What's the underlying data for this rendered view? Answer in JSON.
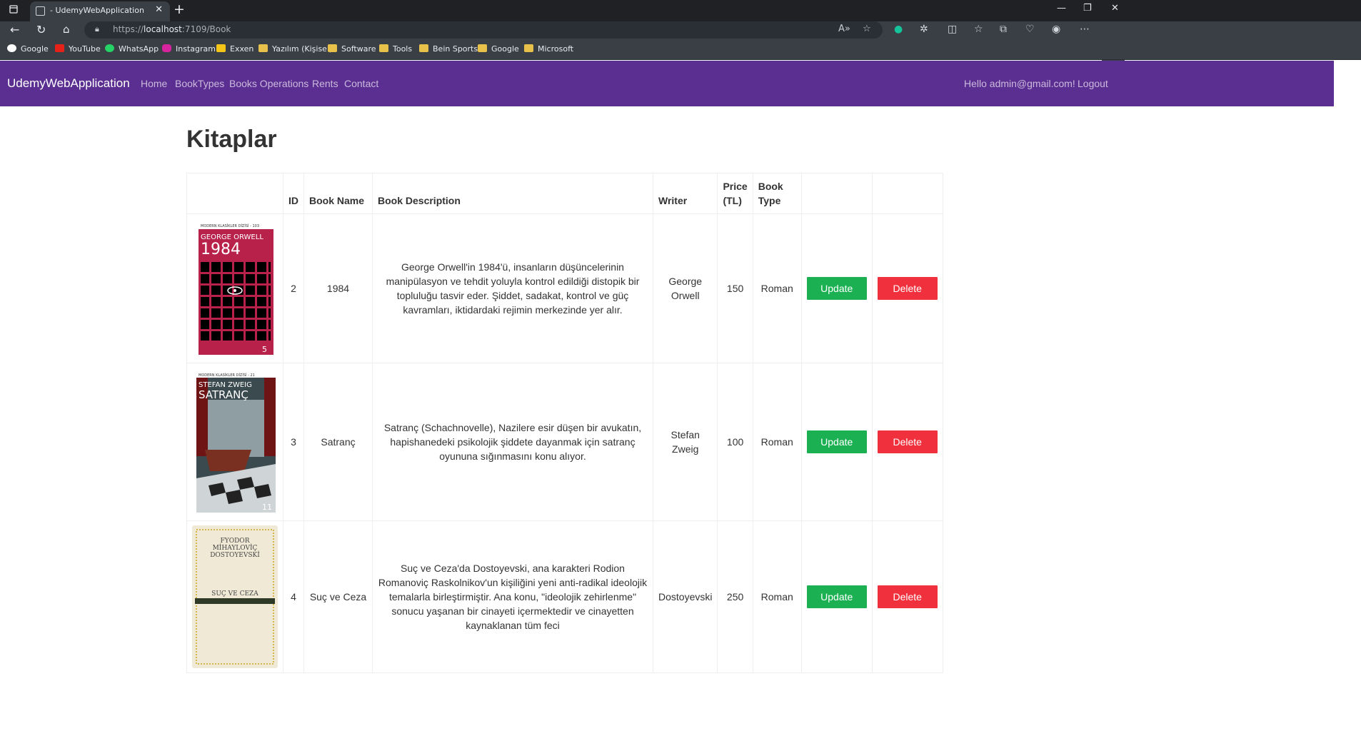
{
  "browser": {
    "tab_title": "- UdemyWebApplication",
    "url_prefix": "https://",
    "url_host": "localhost",
    "url_path": ":7109/Book",
    "bookmarks": [
      {
        "label": "Google",
        "icon": "google-icon",
        "color": "#ffffff"
      },
      {
        "label": "YouTube",
        "icon": "youtube-icon",
        "color": "#e62117"
      },
      {
        "label": "WhatsApp",
        "icon": "whatsapp-icon",
        "color": "#25d366"
      },
      {
        "label": "Instagram",
        "icon": "instagram-icon",
        "color": "#d6249f"
      },
      {
        "label": "Exxen",
        "icon": "exxen-icon",
        "color": "#f5c518"
      },
      {
        "label": "Yazılım (Kişisel)",
        "icon": "folder-icon",
        "color": "#e8c14a"
      },
      {
        "label": "Software",
        "icon": "folder-icon",
        "color": "#e8c14a"
      },
      {
        "label": "Tools",
        "icon": "folder-icon",
        "color": "#e8c14a"
      },
      {
        "label": "Bein Sports",
        "icon": "folder-icon",
        "color": "#e8c14a"
      },
      {
        "label": "Google",
        "icon": "folder-icon",
        "color": "#e8c14a"
      },
      {
        "label": "Microsoft",
        "icon": "folder-icon",
        "color": "#e8c14a"
      }
    ]
  },
  "navbar": {
    "brand": "UdemyWebApplication",
    "links": [
      "Home",
      "BookTypes",
      "Books Operations",
      "Rents",
      "Contact"
    ],
    "greeting": "Hello admin@gmail.com!",
    "logout": "Logout",
    "color": "#5b2e91"
  },
  "page": {
    "title": "Kitaplar"
  },
  "table": {
    "headers": {
      "image": "",
      "id": "ID",
      "name": "Book Name",
      "description": "Book Description",
      "writer": "Writer",
      "price": "Price (TL)",
      "type": "Book Type",
      "update": "",
      "delete": ""
    },
    "rows": [
      {
        "id": "2",
        "name": "1984",
        "description": "George Orwell'in 1984'ü, insanların düşüncelerinin manipülasyon ve tehdit yoluyla kontrol edildiği distopik bir topluluğu tasvir eder. Şiddet, sadakat, kontrol ve güç kavramları, iktidardaki rejimin merkezinde yer alır.",
        "writer": "George Orwell",
        "price": "150",
        "type": "Roman",
        "cover": {
          "series": "MODERN KLASİKLER DİZİSİ - 103",
          "author": "GEORGE ORWELL",
          "title": "1984",
          "number": "5",
          "color": "#b8214a"
        }
      },
      {
        "id": "3",
        "name": "Satranç",
        "description": "Satranç (Schachnovelle), Nazilere esir düşen bir avukatın, hapishanedeki psikolojik şiddete dayanmak için satranç oyununa sığınmasını konu alıyor.",
        "writer": "Stefan Zweig",
        "price": "100",
        "type": "Roman",
        "cover": {
          "series": "MODERN KLASİKLER DİZİSİ - 21",
          "author": "STEFAN ZWEIG",
          "title": "SATRANÇ",
          "number": "11",
          "color": "#7a1f1f"
        }
      },
      {
        "id": "4",
        "name": "Suç ve Ceza",
        "description": "Suç ve Ceza'da Dostoyevski, ana karakteri Rodion Romanoviç Raskolnikov'un kişiliğini yeni anti-radikal ideolojik temalarla birleştirmiştir. Ana konu, \"ideolojik zehirlenme\" sonucu yaşanan bir cinayeti içermektedir ve cinayetten kaynaklanan tüm feci",
        "writer": "Dostoyevski",
        "price": "250",
        "type": "Roman",
        "cover": {
          "series": "",
          "author": "FYODOR MİHAYLOVİÇ DOSTOYEVSKİ",
          "title": "SUÇ VE CEZA",
          "number": "",
          "color": "#efe9d6"
        }
      }
    ],
    "update_label": "Update",
    "delete_label": "Delete"
  }
}
